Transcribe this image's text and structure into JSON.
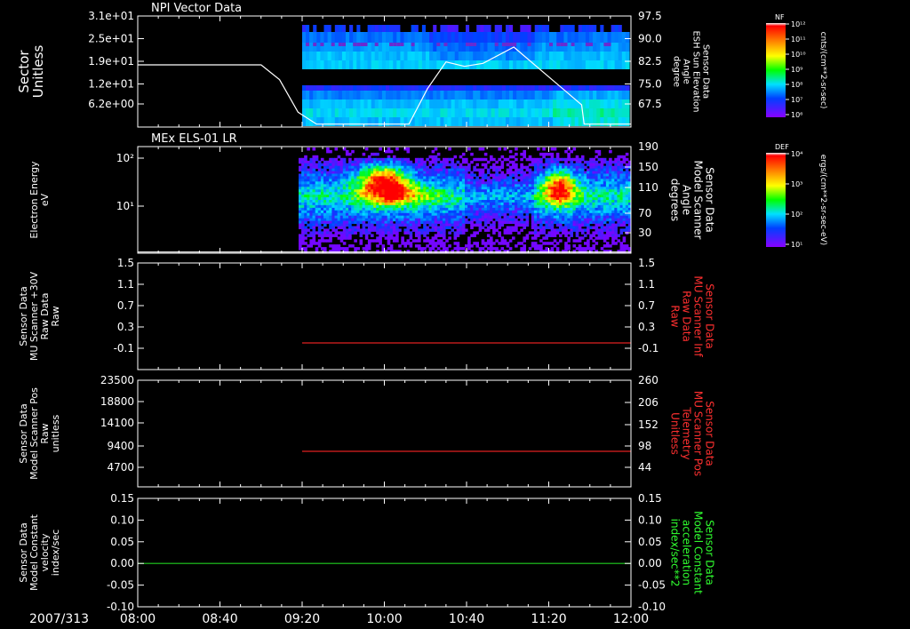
{
  "date_label": "2007/313",
  "time_ticks": [
    "08:00",
    "08:40",
    "09:20",
    "10:00",
    "10:40",
    "11:20",
    "12:00"
  ],
  "time_tick_hours": [
    8.0,
    8.6667,
    9.3333,
    10.0,
    10.6667,
    11.3333,
    12.0
  ],
  "data_start_hour": 9.333,
  "colorbars": [
    {
      "tag": "NF",
      "unit": "cnts/(cm**2-sr-sec)",
      "tick_labels": [
        "10¹²",
        "10¹¹",
        "10¹⁰",
        "10⁹",
        "10⁸",
        "10⁷",
        "10⁶"
      ]
    },
    {
      "tag": "DEF",
      "unit": "ergs/(cm**2-sr-sec-eV)",
      "tick_labels": [
        "10⁴",
        "10³",
        "10²",
        "10¹"
      ]
    }
  ],
  "chart_data": [
    {
      "type": "heatmap",
      "title": "NPI Vector Data",
      "ylabel": [
        "Sector",
        "Unitless"
      ],
      "y_tick_labels": [
        "3.1e+01",
        "2.5e+01",
        "1.9e+01",
        "1.2e+01",
        "6.2e+00"
      ],
      "right_ylabel": [
        "Sensor Data",
        "ESH Sun Elevation",
        "Angle",
        "degree"
      ],
      "right_y_tick_labels": [
        "97.5",
        "90.0",
        "82.5",
        "75.0",
        "67.5"
      ],
      "right_ylim": [
        60.0,
        97.5
      ],
      "overlay_line": {
        "name": "ESH Sun Elevation Angle",
        "x": [
          8.0,
          9.0,
          9.15,
          9.3,
          9.45,
          9.8,
          10.2,
          10.35,
          10.5,
          10.65,
          10.8,
          11.05,
          11.6,
          11.62,
          11.75,
          12.0
        ],
        "y": [
          81.0,
          81.0,
          76.0,
          65.0,
          61.0,
          61.0,
          61.0,
          73.0,
          82.0,
          80.5,
          81.5,
          87.0,
          67.5,
          61.0,
          61.0,
          61.0
        ]
      }
    },
    {
      "type": "heatmap",
      "title": "MEx ELS-01 LR",
      "ylabel": [
        "Electron Energy",
        "eV"
      ],
      "y_tick_labels": [
        "10²",
        "10¹"
      ],
      "right_ylabel": [
        "Sensor Data",
        "Model Scanner",
        "Angle",
        "degrees"
      ],
      "right_y_tick_labels": [
        "190",
        "150",
        "110",
        "70",
        "30"
      ],
      "right_ylim": [
        10,
        190
      ],
      "overlay_line": {
        "name": "Model Scanner Angle",
        "x": [
          8.0,
          12.0
        ],
        "y": [
          12,
          12
        ]
      }
    },
    {
      "type": "line",
      "ylabel": [
        "Sensor Data",
        "MU Scanner +30V",
        "Raw Data",
        "Raw"
      ],
      "y_tick_labels": [
        "1.5",
        "1.1",
        "0.7",
        "0.3",
        "-0.1"
      ],
      "ylim": [
        -0.5,
        1.5
      ],
      "right_ylabel": [
        "Sensor Data",
        "MU Scanner Inf",
        "Raw Data",
        "Raw"
      ],
      "right_y_tick_labels": [
        "1.5",
        "1.1",
        "0.7",
        "0.3",
        "-0.1"
      ],
      "right_label_color": "#ff3030",
      "series": [
        {
          "name": "MU Scanner Inf Raw Data",
          "color": "#e02020",
          "x": [
            9.333,
            12.0
          ],
          "y": [
            0.0,
            0.0
          ]
        }
      ]
    },
    {
      "type": "line",
      "ylabel": [
        "Sensor Data",
        "Model Scanner Pos",
        "Raw",
        "unitless"
      ],
      "y_tick_labels": [
        "23500",
        "18800",
        "14100",
        "9400",
        "4700"
      ],
      "ylim": [
        0,
        23500
      ],
      "right_ylabel": [
        "Sensor Data",
        "MU Scanner Pos",
        "Telemetry",
        "Unitless"
      ],
      "right_y_tick_labels": [
        "260",
        "206",
        "152",
        "98",
        "44"
      ],
      "right_ylim": [
        -10,
        260
      ],
      "right_label_color": "#ff3030",
      "series": [
        {
          "name": "MU Scanner Pos Telemetry",
          "color": "#e02020",
          "x": [
            9.333,
            12.0
          ],
          "y": [
            80,
            80
          ]
        }
      ]
    },
    {
      "type": "line",
      "ylabel": [
        "Sensor Data",
        "Model Constant",
        "velocity",
        "index/sec"
      ],
      "y_tick_labels": [
        "0.15",
        "0.10",
        "0.05",
        "0.00",
        "-0.05",
        "-0.10"
      ],
      "ylim": [
        -0.1,
        0.15
      ],
      "right_ylabel": [
        "Sensor Data",
        "Model Constant",
        "acceleration",
        "index/sec**2"
      ],
      "right_y_tick_labels": [
        "0.15",
        "0.10",
        "0.05",
        "0.00",
        "-0.05",
        "-0.10"
      ],
      "right_label_color": "#30ff30",
      "series": [
        {
          "name": "Model Constant acceleration",
          "color": "#20d020",
          "x": [
            8.0,
            12.0
          ],
          "y": [
            0.0,
            0.0
          ]
        }
      ]
    }
  ]
}
